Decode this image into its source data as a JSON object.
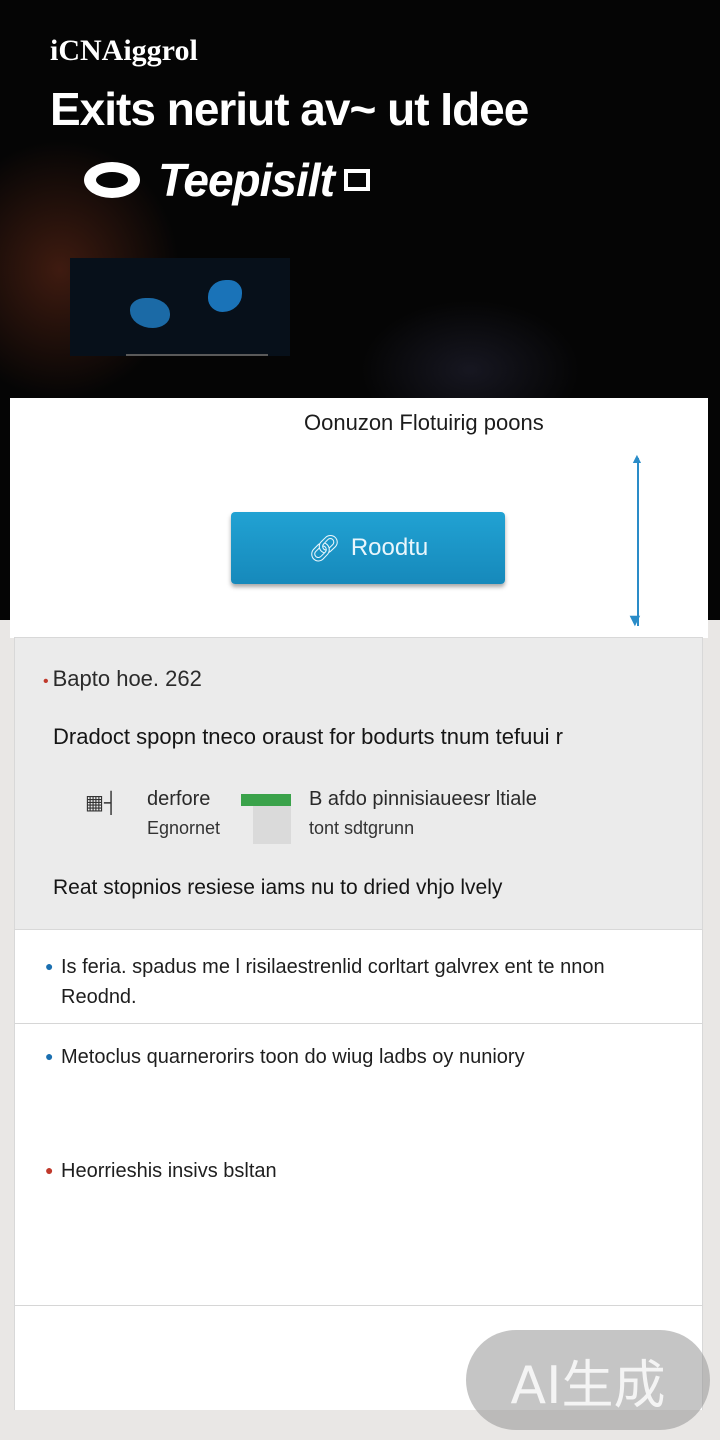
{
  "hero": {
    "brand": "iCNAiggrol",
    "title": "Exits neriut av~ ut Idee",
    "subtitle": "Teepisilt"
  },
  "card": {
    "title": "Oonuzon Flotuirig poons",
    "cta_label": "Roodtu",
    "cta_icon": "link-icon"
  },
  "panel": {
    "date": "Bapto hoe. 262",
    "heading": "Dradoct spopn tneco oraust for bodurts tnum tefuui r",
    "row_line1_left": "derfore",
    "row_line1_right": "B afdo pinnisiaueesr ltiale",
    "row_line2_left": "Egnornet",
    "row_line2_right": "tont sdtgrunn",
    "footer": "Reat stopnios resiese iams nu to dried vhjo lvely"
  },
  "list": {
    "items": [
      {
        "text": "Is feria. spadus me l risilaestrenlid corltart galvrex ent te nnon Reodnd."
      },
      {
        "text": "Metoclus quarnerorirs toon do wiug ladbs oy nuniory"
      },
      {
        "text": "Heorrieshis insivs bsltan"
      }
    ]
  },
  "watermark": "AI生成",
  "colors": {
    "accent": "#1d97c9",
    "hero_bg": "#050505",
    "bullet_red": "#c0392b",
    "bullet_blue": "#1a6fb0"
  }
}
